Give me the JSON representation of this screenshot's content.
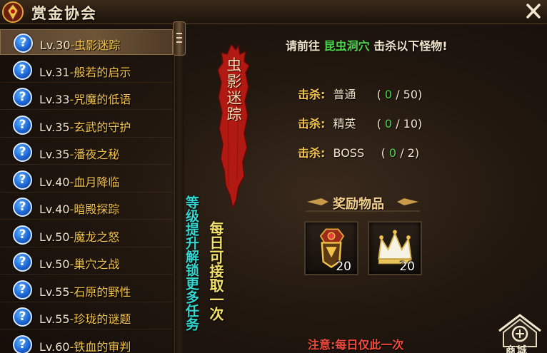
{
  "window": {
    "title": "赏金协会"
  },
  "quests": [
    {
      "level": "Lv.30",
      "name": "虫影迷踪",
      "selected": true
    },
    {
      "level": "Lv.31",
      "name": "般若的启示"
    },
    {
      "level": "Lv.33",
      "name": "咒魔的低语"
    },
    {
      "level": "Lv.35",
      "name": "玄武的守护"
    },
    {
      "level": "Lv.35",
      "name": "潘夜之秘"
    },
    {
      "level": "Lv.40",
      "name": "血月降临"
    },
    {
      "level": "Lv.40",
      "name": "暗殿探踪"
    },
    {
      "level": "Lv.50",
      "name": "魔龙之怒"
    },
    {
      "level": "Lv.50",
      "name": "巢穴之战"
    },
    {
      "level": "Lv.55",
      "name": "石原的野性"
    },
    {
      "level": "Lv.55",
      "name": "珍珑的谜题"
    },
    {
      "level": "Lv.60",
      "name": "铁血的审判"
    }
  ],
  "quest_icon_glyph": "?",
  "side_notes": {
    "unlock": "等级提升解锁更多任务",
    "daily": "每日可接取一次"
  },
  "detail": {
    "banner_title": "虫影迷踪",
    "objective_prefix": "请前往",
    "objective_location": "昆虫洞穴",
    "objective_suffix": "击杀以下怪物!",
    "kill_label": "击杀:",
    "kills": [
      {
        "type": "普通",
        "current": "0",
        "total": "50"
      },
      {
        "type": "精英",
        "current": "0",
        "total": "10"
      },
      {
        "type": "BOSS",
        "current": "0",
        "total": "2"
      }
    ],
    "rewards_title": "奖励物品",
    "rewards": [
      {
        "icon": "medal-icon",
        "count": "20"
      },
      {
        "icon": "crown-icon",
        "count": "20"
      }
    ],
    "note": "注意:每日仅此一次"
  },
  "shop": {
    "label": "商城"
  },
  "colors": {
    "accent_gold": "#f2c24a",
    "highlight_green": "#4cd64a",
    "note_red": "#f04a3a",
    "unlock_cyan": "#34d6d0",
    "daily_yellow": "#f4e26a",
    "banner_red": "#b01a12"
  }
}
